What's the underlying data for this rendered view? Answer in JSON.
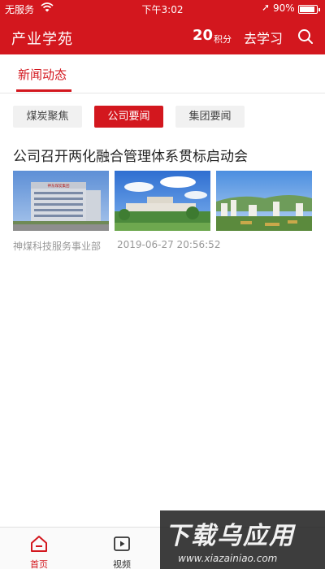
{
  "status_bar": {
    "carrier": "无服务",
    "time": "下午3:02",
    "battery": "90%",
    "battery_level": 0.9
  },
  "header": {
    "title": "产业学苑",
    "score_value": "20",
    "score_unit": "积分",
    "study_label": "去学习",
    "search_icon": "search-icon"
  },
  "tabs": [
    {
      "label": "新闻动态",
      "active": true
    }
  ],
  "categories": [
    {
      "label": "煤炭聚焦",
      "active": false
    },
    {
      "label": "公司要闻",
      "active": true
    },
    {
      "label": "集团要闻",
      "active": false
    }
  ],
  "article": {
    "title": "公司召开两化融合管理体系贯标启动会",
    "source": "神煤科技服务事业部",
    "time": "2019-06-27 20:56:52",
    "sign_text": "神东煤炭集团"
  },
  "bottom_nav": [
    {
      "label": "首页",
      "icon": "home-icon",
      "active": true
    },
    {
      "label": "视频",
      "icon": "video-icon",
      "active": false
    }
  ],
  "watermark": {
    "main": "下载乌应用",
    "url": "www.xiazainiao.com"
  },
  "colors": {
    "brand_red": "#d3171e",
    "chip_inactive_bg": "#f1f1f1",
    "meta_gray": "#999999"
  }
}
